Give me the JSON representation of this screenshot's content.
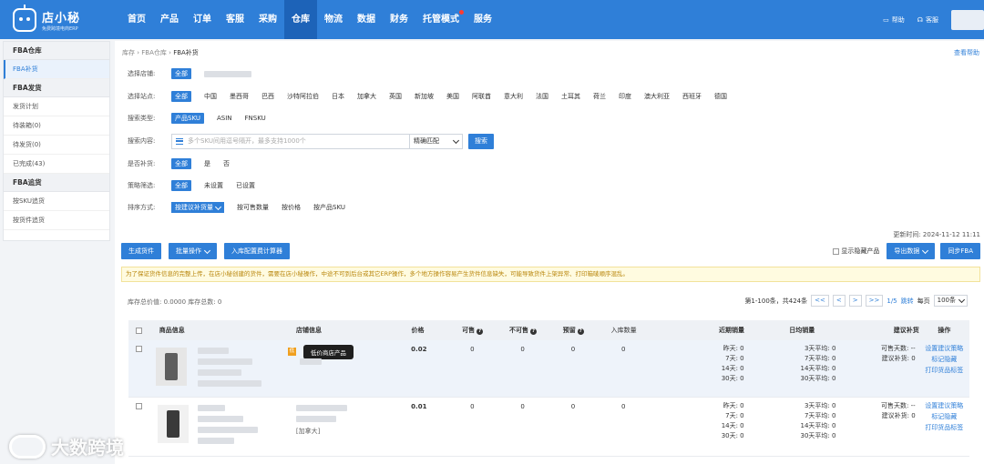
{
  "brand": {
    "name": "店小秘",
    "sub": "免费跨境电商ERP"
  },
  "nav": [
    "首页",
    "产品",
    "订单",
    "客服",
    "采购",
    "仓库",
    "物流",
    "数据",
    "财务",
    "托管模式",
    "服务"
  ],
  "nav_active_index": 5,
  "top_right": {
    "help": "帮助",
    "service": "客服"
  },
  "sidebar": {
    "groups": [
      {
        "title": "FBA仓库",
        "items": [
          "FBA补货"
        ]
      },
      {
        "title": "FBA发货",
        "items": [
          "发货计划",
          "待装箱(0)",
          "待发货(0)",
          "已完成(43)"
        ]
      },
      {
        "title": "FBA追货",
        "items": [
          "按SKU追货",
          "按货件追货"
        ]
      }
    ]
  },
  "breadcrumb": {
    "a": "库存",
    "b": "FBA仓库",
    "c": "FBA补货",
    "sep": "›"
  },
  "help_link": "查看帮助",
  "filters": {
    "shop": {
      "label": "选择店铺:",
      "all": "全部"
    },
    "site": {
      "label": "选择站点:",
      "options": [
        "全部",
        "中国",
        "墨西哥",
        "巴西",
        "沙特阿拉伯",
        "日本",
        "加拿大",
        "英国",
        "新加坡",
        "美国",
        "阿联酋",
        "意大利",
        "法国",
        "土耳其",
        "荷兰",
        "印度",
        "澳大利亚",
        "西班牙",
        "德国"
      ]
    },
    "search_type": {
      "label": "搜索类型:",
      "options": [
        "产品SKU",
        "ASIN",
        "FNSKU"
      ]
    },
    "search": {
      "label": "搜索内容:",
      "placeholder": "多个SKU间用逗号隔开，最多支持1000个",
      "match": "精确匹配",
      "button": "搜索"
    },
    "restock": {
      "label": "是否补货:",
      "options": [
        "全部",
        "是",
        "否"
      ]
    },
    "strategy": {
      "label": "策略筛选:",
      "options": [
        "全部",
        "未设置",
        "已设置"
      ]
    },
    "sort": {
      "label": "排序方式:",
      "selected": "按建议补货量",
      "options": [
        "按可售数量",
        "按价格",
        "按产品SKU"
      ]
    }
  },
  "update_time": "更新时间: 2024-11-12 11:11",
  "actions": {
    "create": "生成货件",
    "batch": "批量操作",
    "calc": "入库配置费计算器",
    "hide_label": "显示隐藏产品",
    "export": "导出数据",
    "sync": "同步FBA"
  },
  "notice": "为了保证货件信息的完整上传，在店小秘创建的货件，需要在店小秘操作，中途不可到后台或其它ERP操作，多个地方操作容易产生货件信息缺失，可能导致货件上架异常、打印箱唛顺序混乱。",
  "stats": "库存总价值: 0.0000  库存总数: 0",
  "pager": {
    "range": "第1-100条，共424条",
    "first": "<<",
    "prev": "<",
    "next": ">",
    "last": ">>",
    "page": "1/5",
    "jump": "跳转",
    "per_page_label": "每页",
    "per_page": "100条"
  },
  "table": {
    "headers": {
      "product": "商品信息",
      "shop": "店铺信息",
      "price": "价格",
      "sellable": "可售",
      "unsellable": "不可售",
      "reserved": "预留",
      "inbound": "入库数量",
      "recent": "近期销量",
      "daily": "日均销量",
      "rec": "建议补货",
      "op": "操作",
      "q": "?"
    },
    "rows": [
      {
        "price": "0.02",
        "sellable": "0",
        "unsellable": "0",
        "reserved": "0",
        "inbound": "0",
        "tag": "低",
        "tooltip": "低价商店产品",
        "recent": [
          "昨天: 0",
          "7天: 0",
          "14天: 0",
          "30天: 0"
        ],
        "daily": [
          "3天平均: 0",
          "7天平均: 0",
          "14天平均: 0",
          "30天平均: 0"
        ],
        "rec": [
          "可售天数: --",
          "建议补货: 0"
        ],
        "ops": [
          "设置建议策略",
          "标记隐藏",
          "打印货品标签"
        ]
      },
      {
        "price": "0.01",
        "sellable": "0",
        "unsellable": "0",
        "reserved": "0",
        "inbound": "0",
        "shop_extra": "[加拿大]",
        "recent": [
          "昨天: 0",
          "7天: 0",
          "14天: 0",
          "30天: 0"
        ],
        "daily": [
          "3天平均: 0",
          "7天平均: 0",
          "14天平均: 0",
          "30天平均: 0"
        ],
        "rec": [
          "可售天数: --",
          "建议补货: 0"
        ],
        "ops": [
          "设置建议策略",
          "标记隐藏",
          "打印货品标签"
        ]
      }
    ]
  },
  "watermark": "大数跨境",
  "colors": {
    "primary": "#2f7fd8",
    "nav_active": "#1d63b8",
    "notice_bg": "#fffbe0"
  }
}
